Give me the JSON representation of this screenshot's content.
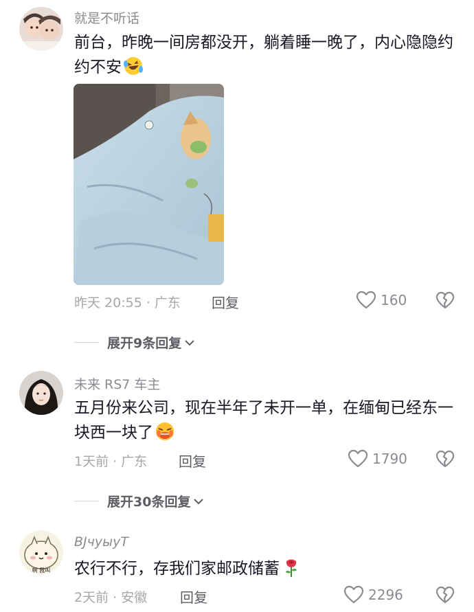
{
  "comments": [
    {
      "username": "就是不听话",
      "text": "前台，昨晚一间房都没开，躺着睡一晚了，内心隐隐约约不安",
      "emoji": "laughing-crying-emoji",
      "meta": "昨天 20:55 · 广东",
      "reply": "回复",
      "likes": "160",
      "expand": "展开9条回复"
    },
    {
      "username": "未来 RS7 车主",
      "text": "五月份来公司，现在半年了未开一单，在缅甸已经东一块西一块了",
      "emoji": "crying-face-emoji",
      "meta": "1天前 · 广东",
      "reply": "回复",
      "likes": "1790",
      "expand": "展开30条回复"
    },
    {
      "username": "ВJчуыуТ",
      "text": "农行不行，存我们家邮政储蓄",
      "emoji": "rose-emoji",
      "meta": "2天前 · 安徽",
      "reply": "回复",
      "likes": "2296"
    }
  ],
  "avatar3_caption": "啊 我叫",
  "colors": {
    "text": "#161823",
    "secondary": "#8a8b91",
    "meta": "#a6a7ab"
  }
}
